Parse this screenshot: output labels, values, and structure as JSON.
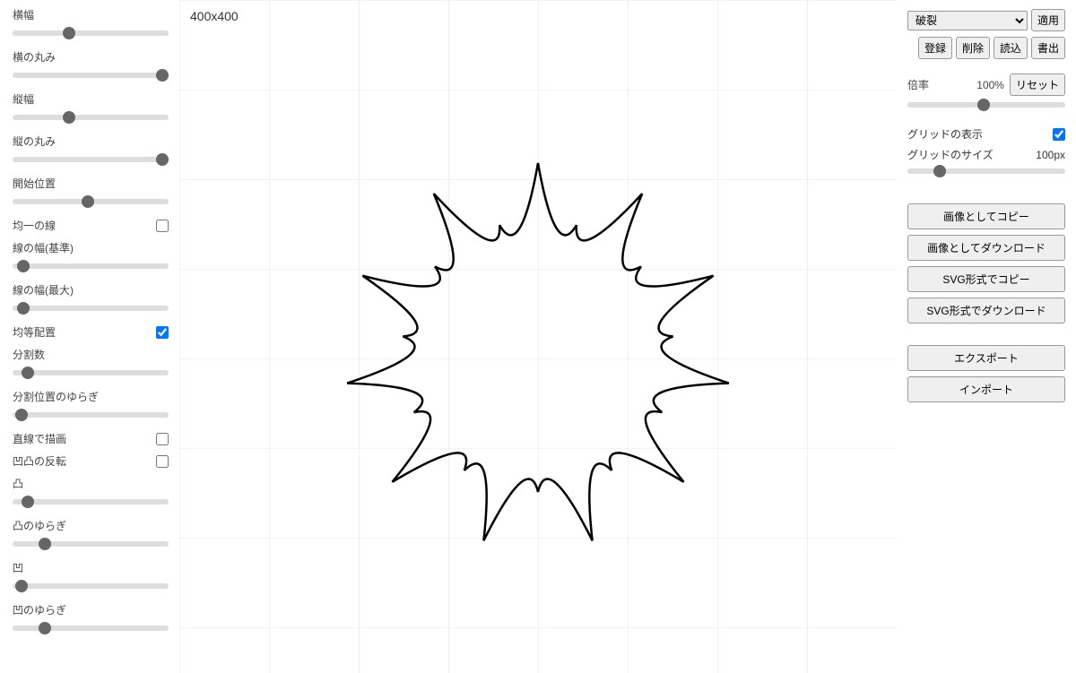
{
  "left": {
    "width_label": "横幅",
    "width_value": 35,
    "hround_label": "横の丸み",
    "hround_value": 100,
    "height_label": "縦幅",
    "height_value": 35,
    "vround_label": "縦の丸み",
    "vround_value": 100,
    "start_label": "開始位置",
    "start_value": 48,
    "uniform_line_label": "均一の線",
    "uniform_line_checked": false,
    "line_base_label": "線の幅(基準)",
    "line_base_value": 3,
    "line_max_label": "線の幅(最大)",
    "line_max_value": 3,
    "even_dist_label": "均等配置",
    "even_dist_checked": true,
    "divisions_label": "分割数",
    "divisions_value": 6,
    "div_jitter_label": "分割位置のゆらぎ",
    "div_jitter_value": 2,
    "straight_label": "直線で描画",
    "straight_checked": false,
    "invert_label": "凹凸の反転",
    "invert_checked": false,
    "convex_label": "凸",
    "convex_value": 6,
    "convex_jitter_label": "凸のゆらぎ",
    "convex_jitter_value": 18,
    "concave_label": "凹",
    "concave_value": 2,
    "concave_jitter_label": "凹のゆらぎ",
    "concave_jitter_value": 18
  },
  "canvas": {
    "size_label": "400x400"
  },
  "right": {
    "preset_selected": "破裂",
    "apply_label": "適用",
    "register_label": "登録",
    "delete_label": "削除",
    "load_label": "読込",
    "save_label": "書出",
    "zoom_label": "倍率",
    "zoom_value": "100%",
    "reset_label": "リセット",
    "grid_show_label": "グリッドの表示",
    "grid_show_checked": true,
    "grid_size_label": "グリッドのサイズ",
    "grid_size_text": "100px",
    "grid_size_value": 18,
    "copy_image_label": "画像としてコピー",
    "download_image_label": "画像としてダウンロード",
    "copy_svg_label": "SVG形式でコピー",
    "download_svg_label": "SVG形式でダウンロード",
    "export_label": "エクスポート",
    "import_label": "インポート"
  }
}
